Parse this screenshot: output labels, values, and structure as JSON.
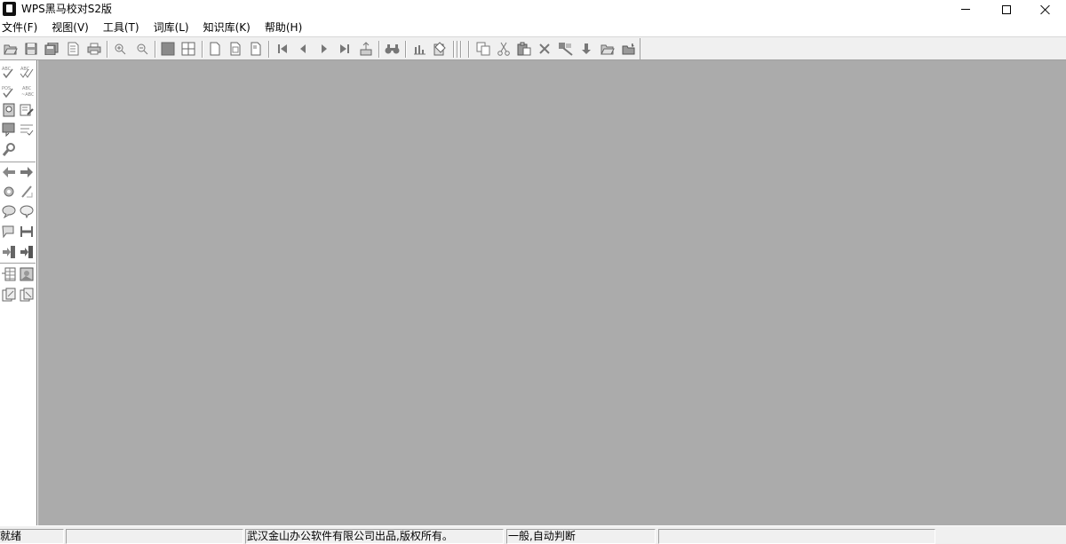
{
  "window": {
    "title": "WPS黑马校对S2版"
  },
  "menu": {
    "items": [
      {
        "label": "文件(F)"
      },
      {
        "label": "视图(V)"
      },
      {
        "label": "工具(T)"
      },
      {
        "label": "词库(L)"
      },
      {
        "label": "知识库(K)"
      },
      {
        "label": "帮助(H)"
      }
    ]
  },
  "toolbar": {
    "icons": [
      "open-folder-icon",
      "save-icon",
      "save-all-icon",
      "document-list-icon",
      "print-icon",
      "zoom-in-icon",
      "zoom-out-icon",
      "single-view-icon",
      "grid-view-icon",
      "page-icon",
      "page-frame-icon",
      "page-corner-icon",
      "first-icon",
      "previous-icon",
      "next-icon",
      "last-icon",
      "export-icon",
      "find-icon",
      "chart-icon",
      "clipboard-icon",
      "copy-icon",
      "cut-icon",
      "paste-icon",
      "delete-icon",
      "replace-icon",
      "down-arrow-icon",
      "open-folder-2-icon",
      "save-folder-icon"
    ]
  },
  "sidebar": {
    "icons": [
      "spellcheck-icon",
      "spellcheck-all-icon",
      "pos-check-icon",
      "abc-compare-icon",
      "document-check-icon",
      "document-edit-icon",
      "document-mark-icon",
      "list-check-icon",
      "wrench-icon",
      "arrow-left-icon",
      "arrow-right-icon",
      "settings-icon",
      "slash-icon",
      "bubble-check-icon",
      "bubble-icon",
      "flag-icon",
      "merge-icon",
      "insert-left-icon",
      "insert-right-icon",
      "table-icon",
      "image-icon",
      "page-compare-icon",
      "page-compare-2-icon"
    ]
  },
  "status": {
    "ready": "就绪",
    "copyright": "武汉金山办公软件有限公司出品,版权所有。",
    "mode": "一般,自动判断"
  }
}
